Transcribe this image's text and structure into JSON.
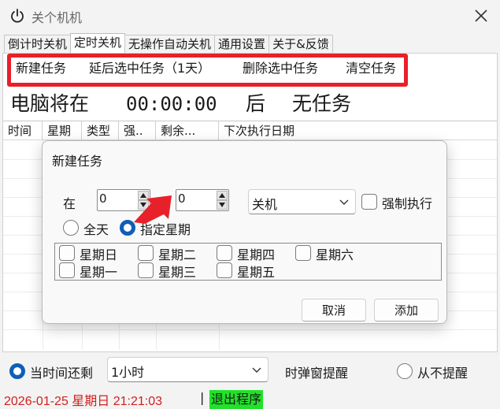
{
  "window": {
    "title": "关个机机",
    "icon": "power-icon",
    "close_icon": "close-icon"
  },
  "tabs": [
    {
      "label": "倒计时关机"
    },
    {
      "label": "定时关机",
      "active": true
    },
    {
      "label": "无操作自动关机"
    },
    {
      "label": "通用设置"
    },
    {
      "label": "关于&反馈"
    }
  ],
  "toolbar": {
    "new_task": "新建任务",
    "postpone_task": "延后选中任务（1天）",
    "delete_task": "删除选中任务",
    "clear_tasks": "清空任务",
    "highlight_color": "#e8202a"
  },
  "status": {
    "prefix": "电脑将在",
    "time": "00:00:00",
    "suffix": "后",
    "task": "无任务"
  },
  "table": {
    "columns": [
      "时间",
      "星期",
      "类型",
      "强..",
      "剩余...",
      "下次执行日期"
    ]
  },
  "dialog": {
    "title": "新建任务",
    "at_label": "在",
    "hour_value": "0",
    "minute_value": "0",
    "action_value": "关机",
    "force_label": "强制执行",
    "force_checked": false,
    "all_day_label": "全天",
    "specific_day_label": "指定星期",
    "specific_day_selected": true,
    "days": [
      "星期日",
      "星期二",
      "星期四",
      "星期六",
      "星期一",
      "星期三",
      "星期五"
    ],
    "cancel_label": "取消",
    "add_label": "添加"
  },
  "bottom": {
    "remain_label": "当时间还剩",
    "remain_selected": true,
    "remain_value": "1小时",
    "popup_label": "时弹窗提醒",
    "never_label": "从不提醒",
    "datetime": "2026-01-25 星期日 21:21:03",
    "separator": "|",
    "exit_label": "退出程序",
    "exit_color": "#22e12a",
    "datetime_color": "#d0201e"
  }
}
